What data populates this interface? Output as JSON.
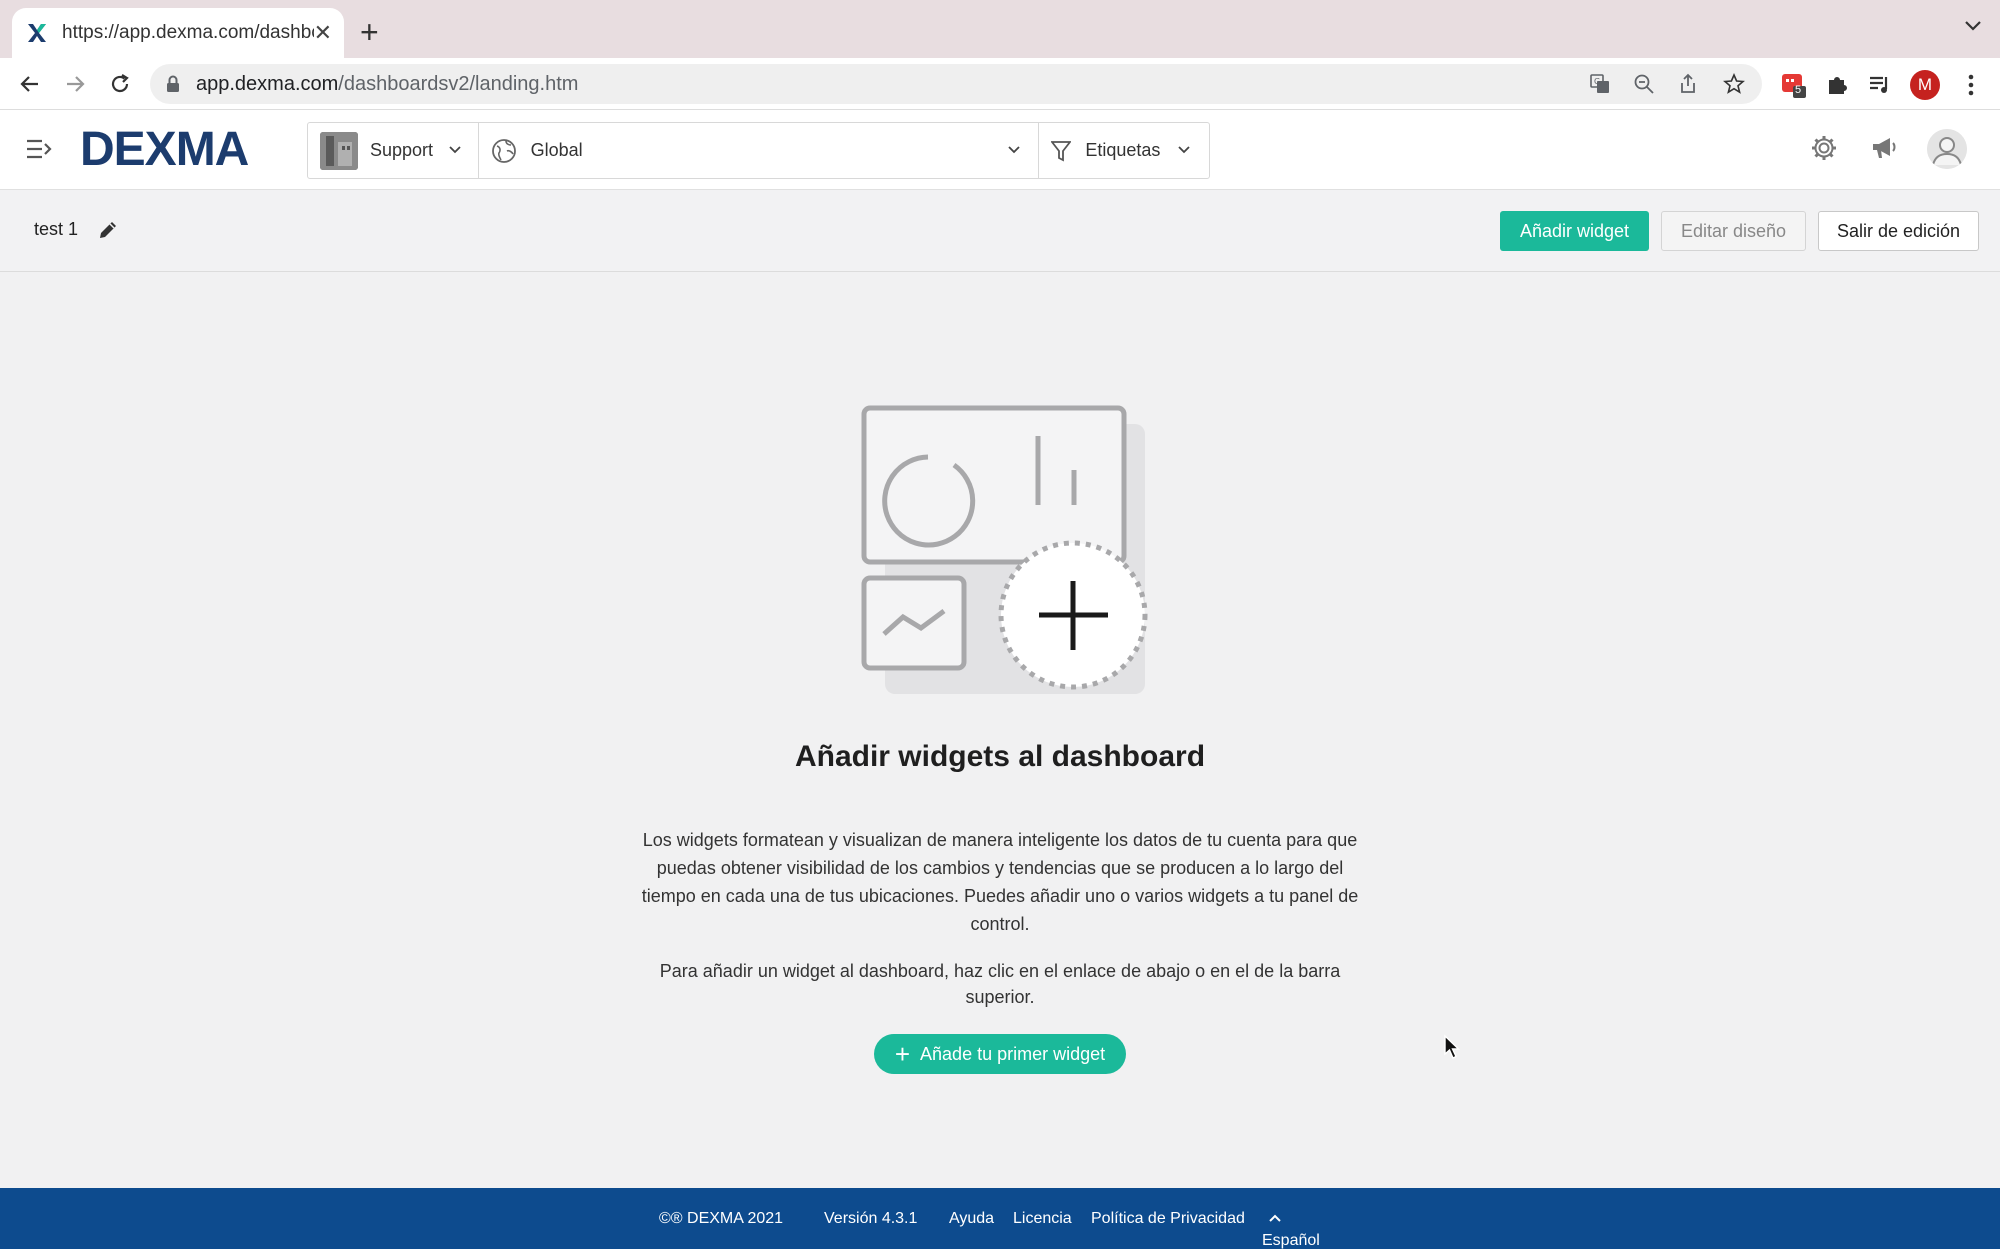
{
  "browser": {
    "tab_title": "https://app.dexma.com/dashbc",
    "url_host": "app.dexma.com",
    "url_path": "/dashboardsv2/landing.htm",
    "extension_badge": "5",
    "profile_initial": "M"
  },
  "header": {
    "logo": "DEXMA",
    "org_selector": "Support",
    "location_selector": "Global",
    "tags_selector": "Etiquetas"
  },
  "editbar": {
    "dashboard_name": "test 1",
    "add_widget": "Añadir widget",
    "edit_layout": "Editar diseño",
    "exit_edit": "Salir de edición"
  },
  "empty_state": {
    "title": "Añadir widgets al dashboard",
    "description": "Los widgets formatean y visualizan de manera inteligente los datos de tu cuenta para que puedas obtener visibilidad de los cambios y tendencias que se producen a lo largo del tiempo en cada una de tus ubicaciones. Puedes añadir uno o varios widgets a tu panel de control.",
    "instruction": "Para añadir un widget al dashboard, haz clic en el enlace de abajo o en el de la barra superior.",
    "cta": "Añade tu primer widget"
  },
  "footer": {
    "copyright": "©® DEXMA 2021",
    "version": "Versión 4.3.1",
    "help": "Ayuda",
    "license": "Licencia",
    "privacy": "Política de Privacidad",
    "language": "Español"
  },
  "colors": {
    "accent": "#1bb99a",
    "footer_bg": "#0d4b8e",
    "logo": "#1c3c6e"
  }
}
